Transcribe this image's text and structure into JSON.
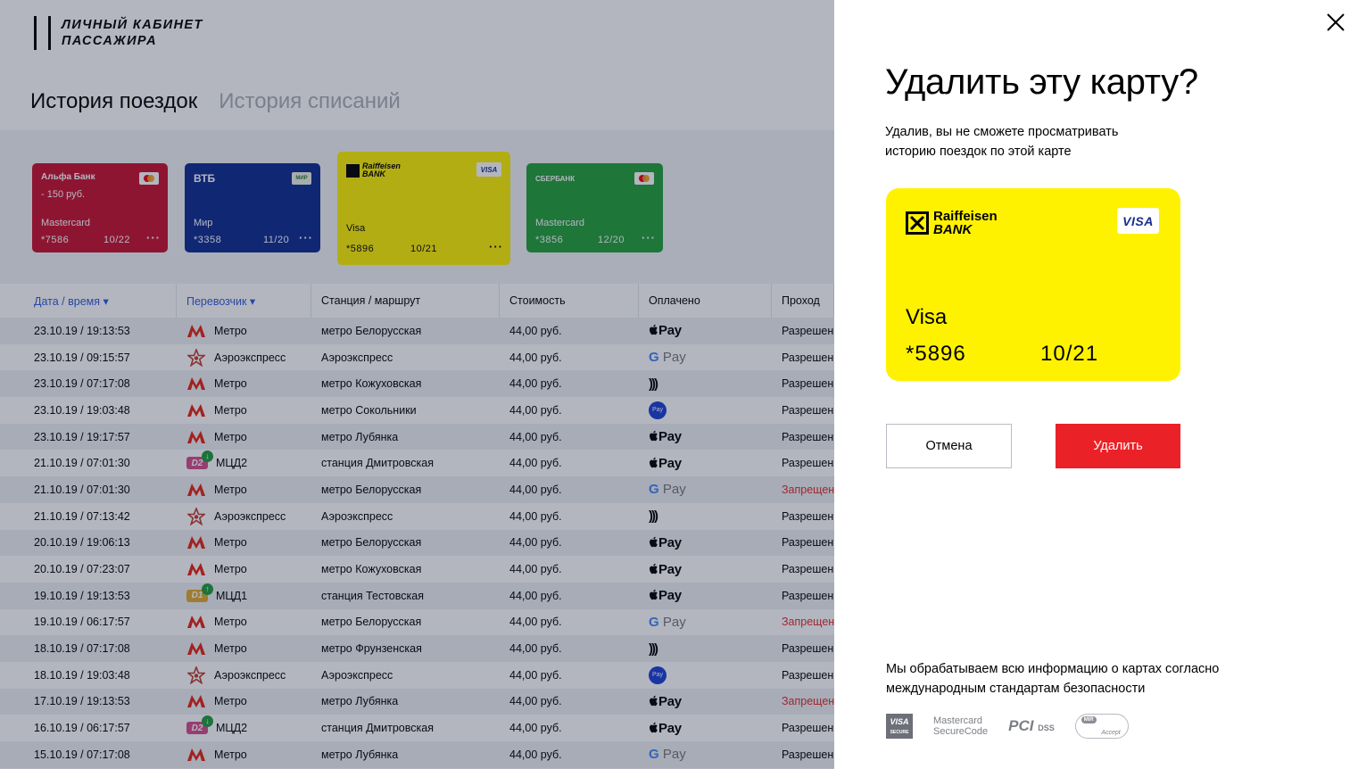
{
  "header": {
    "logo_line1": "ЛИЧНЫЙ КАБИНЕТ",
    "logo_line2": "ПАССАЖИРА",
    "tabs": [
      {
        "label": "История поездок",
        "active": true
      },
      {
        "label": "История списаний",
        "active": false
      }
    ]
  },
  "mini_cards": [
    {
      "bank": "Альфа Банк",
      "amount": "- 150 руб.",
      "type": "Mastercard",
      "number": "*7586",
      "expiry": "10/22",
      "color": "#c8102e",
      "badge_text": "mc"
    },
    {
      "bank": "ВТБ",
      "amount": "",
      "type": "Мир",
      "number": "*3358",
      "expiry": "11/20",
      "color": "#0d2a8f",
      "badge_text": "МИР"
    },
    {
      "bank": "Raiffeisen BANK",
      "amount": "",
      "type": "Visa",
      "number": "*5896",
      "expiry": "10/21",
      "color": "#fff200",
      "badge_text": "VISA"
    },
    {
      "bank": "СБЕРБАНК",
      "amount": "",
      "type": "Mastercard",
      "number": "*3856",
      "expiry": "12/20",
      "color": "#21a038",
      "badge_text": "mc"
    }
  ],
  "more_icon_text": "···",
  "table": {
    "headers": [
      "Дата / время ▾",
      "Перевозчик ▾",
      "Станция / маршрут",
      "Стоимость",
      "Оплачено",
      "Проход"
    ],
    "rows": [
      {
        "datetime": "23.10.19 / 19:13:53",
        "carrier_type": "metro",
        "carrier": "Метро",
        "station": "метро Белорусская",
        "cost": "44,00 руб.",
        "paid": "apple",
        "status": "Разрешен",
        "denied": false
      },
      {
        "datetime": "23.10.19 / 09:15:57",
        "carrier_type": "aero",
        "carrier": "Аэроэкспресс",
        "station": "Аэроэкспресс",
        "cost": "44,00 руб.",
        "paid": "google",
        "status": "Разрешен",
        "denied": false
      },
      {
        "datetime": "23.10.19 / 07:17:08",
        "carrier_type": "metro",
        "carrier": "Метро",
        "station": "метро Кожуховская",
        "cost": "44,00 руб.",
        "paid": "contactless",
        "status": "Разрешен",
        "denied": false
      },
      {
        "datetime": "23.10.19 / 19:03:48",
        "carrier_type": "metro",
        "carrier": "Метро",
        "station": "метро Сокольники",
        "cost": "44,00 руб.",
        "paid": "samsung",
        "status": "Разрешен",
        "denied": false
      },
      {
        "datetime": "23.10.19 / 19:17:57",
        "carrier_type": "metro",
        "carrier": "Метро",
        "station": "метро Лубянка",
        "cost": "44,00 руб.",
        "paid": "apple",
        "status": "Разрешен",
        "denied": false
      },
      {
        "datetime": "21.10.19 / 07:01:30",
        "carrier_type": "d2",
        "carrier": "МЦД2",
        "station": "станция Дмитровская",
        "cost": "44,00 руб.",
        "paid": "apple",
        "status": "Разрешен",
        "denied": false
      },
      {
        "datetime": "21.10.19 / 07:01:30",
        "carrier_type": "metro",
        "carrier": "Метро",
        "station": "метро Белорусская",
        "cost": "44,00 руб.",
        "paid": "google",
        "status": "Запрещен",
        "denied": true
      },
      {
        "datetime": "21.10.19 / 07:13:42",
        "carrier_type": "aero",
        "carrier": "Аэроэкспресс",
        "station": "Аэроэкспресс",
        "cost": "44,00 руб.",
        "paid": "contactless",
        "status": "Разрешен",
        "denied": false
      },
      {
        "datetime": "20.10.19 / 19:06:13",
        "carrier_type": "metro",
        "carrier": "Метро",
        "station": "метро Белорусская",
        "cost": "44,00 руб.",
        "paid": "apple",
        "status": "Разрешен",
        "denied": false
      },
      {
        "datetime": "20.10.19 / 07:23:07",
        "carrier_type": "metro",
        "carrier": "Метро",
        "station": "метро Кожуховская",
        "cost": "44,00 руб.",
        "paid": "apple",
        "status": "Разрешен",
        "denied": false
      },
      {
        "datetime": "19.10.19 / 19:13:53",
        "carrier_type": "d1",
        "carrier": "МЦД1",
        "station": "станция Тестовская",
        "cost": "44,00 руб.",
        "paid": "apple",
        "status": "Разрешен",
        "denied": false
      },
      {
        "datetime": "19.10.19 / 06:17:57",
        "carrier_type": "metro",
        "carrier": "Метро",
        "station": "метро Белорусская",
        "cost": "44,00 руб.",
        "paid": "google",
        "status": "Запрещен",
        "denied": true
      },
      {
        "datetime": "18.10.19 / 07:17:08",
        "carrier_type": "metro",
        "carrier": "Метро",
        "station": "метро Фрунзенская",
        "cost": "44,00 руб.",
        "paid": "contactless",
        "status": "Разрешен",
        "denied": false
      },
      {
        "datetime": "18.10.19 / 19:03:48",
        "carrier_type": "aero",
        "carrier": "Аэроэкспресс",
        "station": "Аэроэкспресс",
        "cost": "44,00 руб.",
        "paid": "samsung",
        "status": "Разрешен",
        "denied": false
      },
      {
        "datetime": "17.10.19 / 19:13:53",
        "carrier_type": "metro",
        "carrier": "Метро",
        "station": "метро Лубянка",
        "cost": "44,00 руб.",
        "paid": "apple",
        "status": "Запрещен",
        "denied": true
      },
      {
        "datetime": "16.10.19 / 06:17:57",
        "carrier_type": "d2",
        "carrier": "МЦД2",
        "station": "станция Дмитровская",
        "cost": "44,00 руб.",
        "paid": "apple",
        "status": "Разрешен",
        "denied": false
      },
      {
        "datetime": "15.10.19 / 07:17:08",
        "carrier_type": "metro",
        "carrier": "Метро",
        "station": "метро Лубянка",
        "cost": "44,00 руб.",
        "paid": "google",
        "status": "Разрешен",
        "denied": false
      }
    ]
  },
  "pay_labels": {
    "apple": "Pay",
    "google": "Pay",
    "samsung": "Pay",
    "contactless": ")))"
  },
  "d_badges": {
    "d1": "D1",
    "d2": "D2"
  },
  "dialog": {
    "title": "Удалить эту карту?",
    "description": "Удалив, вы не сможете просматривать историю поездок по этой карте",
    "card": {
      "bank_line1": "Raiffeisen",
      "bank_line2": "BANK",
      "badge": "VISA",
      "type": "Visa",
      "number": "*5896",
      "expiry": "10/21",
      "color": "#fff200"
    },
    "cancel_label": "Отмена",
    "delete_label": "Удалить",
    "security_text": "Мы обрабатываем всю информацию о картах согласно международным стандартам безопасности",
    "security_logos": {
      "visa": "VISA",
      "visa_sub": "SECURE",
      "mc_line1": "Mastercard",
      "mc_line2": "SecureCode",
      "pci": "PCI",
      "pci_sub": "DSS",
      "mir": "MIR",
      "mir_sub": "Accept"
    }
  },
  "colors": {
    "accent_red": "#ea2127",
    "link_blue": "#2d5bd7",
    "denied_red": "#e32b2b"
  }
}
